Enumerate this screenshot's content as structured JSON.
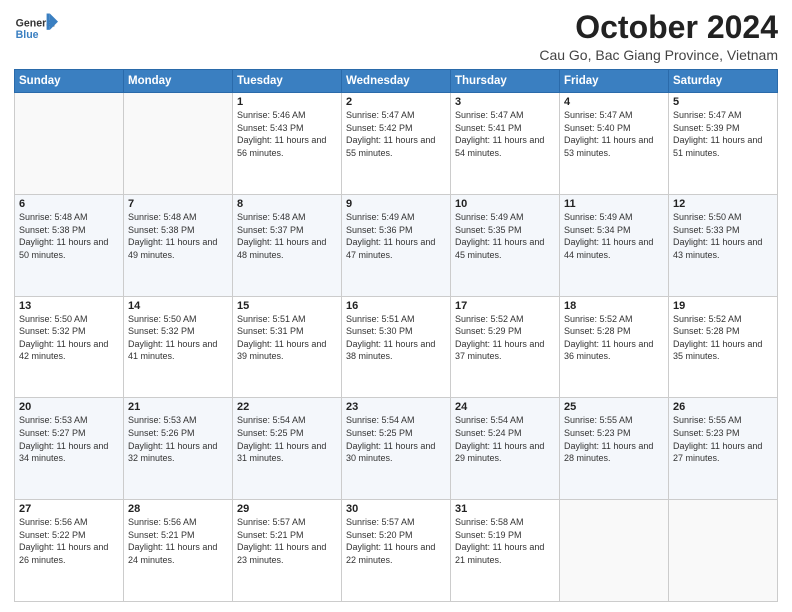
{
  "header": {
    "logo": {
      "general": "General",
      "blue": "Blue"
    },
    "title": "October 2024",
    "subtitle": "Cau Go, Bac Giang Province, Vietnam"
  },
  "weekdays": [
    "Sunday",
    "Monday",
    "Tuesday",
    "Wednesday",
    "Thursday",
    "Friday",
    "Saturday"
  ],
  "weeks": [
    [
      {
        "day": "",
        "info": ""
      },
      {
        "day": "",
        "info": ""
      },
      {
        "day": "1",
        "info": "Sunrise: 5:46 AM\nSunset: 5:43 PM\nDaylight: 11 hours and 56 minutes."
      },
      {
        "day": "2",
        "info": "Sunrise: 5:47 AM\nSunset: 5:42 PM\nDaylight: 11 hours and 55 minutes."
      },
      {
        "day": "3",
        "info": "Sunrise: 5:47 AM\nSunset: 5:41 PM\nDaylight: 11 hours and 54 minutes."
      },
      {
        "day": "4",
        "info": "Sunrise: 5:47 AM\nSunset: 5:40 PM\nDaylight: 11 hours and 53 minutes."
      },
      {
        "day": "5",
        "info": "Sunrise: 5:47 AM\nSunset: 5:39 PM\nDaylight: 11 hours and 51 minutes."
      }
    ],
    [
      {
        "day": "6",
        "info": "Sunrise: 5:48 AM\nSunset: 5:38 PM\nDaylight: 11 hours and 50 minutes."
      },
      {
        "day": "7",
        "info": "Sunrise: 5:48 AM\nSunset: 5:38 PM\nDaylight: 11 hours and 49 minutes."
      },
      {
        "day": "8",
        "info": "Sunrise: 5:48 AM\nSunset: 5:37 PM\nDaylight: 11 hours and 48 minutes."
      },
      {
        "day": "9",
        "info": "Sunrise: 5:49 AM\nSunset: 5:36 PM\nDaylight: 11 hours and 47 minutes."
      },
      {
        "day": "10",
        "info": "Sunrise: 5:49 AM\nSunset: 5:35 PM\nDaylight: 11 hours and 45 minutes."
      },
      {
        "day": "11",
        "info": "Sunrise: 5:49 AM\nSunset: 5:34 PM\nDaylight: 11 hours and 44 minutes."
      },
      {
        "day": "12",
        "info": "Sunrise: 5:50 AM\nSunset: 5:33 PM\nDaylight: 11 hours and 43 minutes."
      }
    ],
    [
      {
        "day": "13",
        "info": "Sunrise: 5:50 AM\nSunset: 5:32 PM\nDaylight: 11 hours and 42 minutes."
      },
      {
        "day": "14",
        "info": "Sunrise: 5:50 AM\nSunset: 5:32 PM\nDaylight: 11 hours and 41 minutes."
      },
      {
        "day": "15",
        "info": "Sunrise: 5:51 AM\nSunset: 5:31 PM\nDaylight: 11 hours and 39 minutes."
      },
      {
        "day": "16",
        "info": "Sunrise: 5:51 AM\nSunset: 5:30 PM\nDaylight: 11 hours and 38 minutes."
      },
      {
        "day": "17",
        "info": "Sunrise: 5:52 AM\nSunset: 5:29 PM\nDaylight: 11 hours and 37 minutes."
      },
      {
        "day": "18",
        "info": "Sunrise: 5:52 AM\nSunset: 5:28 PM\nDaylight: 11 hours and 36 minutes."
      },
      {
        "day": "19",
        "info": "Sunrise: 5:52 AM\nSunset: 5:28 PM\nDaylight: 11 hours and 35 minutes."
      }
    ],
    [
      {
        "day": "20",
        "info": "Sunrise: 5:53 AM\nSunset: 5:27 PM\nDaylight: 11 hours and 34 minutes."
      },
      {
        "day": "21",
        "info": "Sunrise: 5:53 AM\nSunset: 5:26 PM\nDaylight: 11 hours and 32 minutes."
      },
      {
        "day": "22",
        "info": "Sunrise: 5:54 AM\nSunset: 5:25 PM\nDaylight: 11 hours and 31 minutes."
      },
      {
        "day": "23",
        "info": "Sunrise: 5:54 AM\nSunset: 5:25 PM\nDaylight: 11 hours and 30 minutes."
      },
      {
        "day": "24",
        "info": "Sunrise: 5:54 AM\nSunset: 5:24 PM\nDaylight: 11 hours and 29 minutes."
      },
      {
        "day": "25",
        "info": "Sunrise: 5:55 AM\nSunset: 5:23 PM\nDaylight: 11 hours and 28 minutes."
      },
      {
        "day": "26",
        "info": "Sunrise: 5:55 AM\nSunset: 5:23 PM\nDaylight: 11 hours and 27 minutes."
      }
    ],
    [
      {
        "day": "27",
        "info": "Sunrise: 5:56 AM\nSunset: 5:22 PM\nDaylight: 11 hours and 26 minutes."
      },
      {
        "day": "28",
        "info": "Sunrise: 5:56 AM\nSunset: 5:21 PM\nDaylight: 11 hours and 24 minutes."
      },
      {
        "day": "29",
        "info": "Sunrise: 5:57 AM\nSunset: 5:21 PM\nDaylight: 11 hours and 23 minutes."
      },
      {
        "day": "30",
        "info": "Sunrise: 5:57 AM\nSunset: 5:20 PM\nDaylight: 11 hours and 22 minutes."
      },
      {
        "day": "31",
        "info": "Sunrise: 5:58 AM\nSunset: 5:19 PM\nDaylight: 11 hours and 21 minutes."
      },
      {
        "day": "",
        "info": ""
      },
      {
        "day": "",
        "info": ""
      }
    ]
  ]
}
